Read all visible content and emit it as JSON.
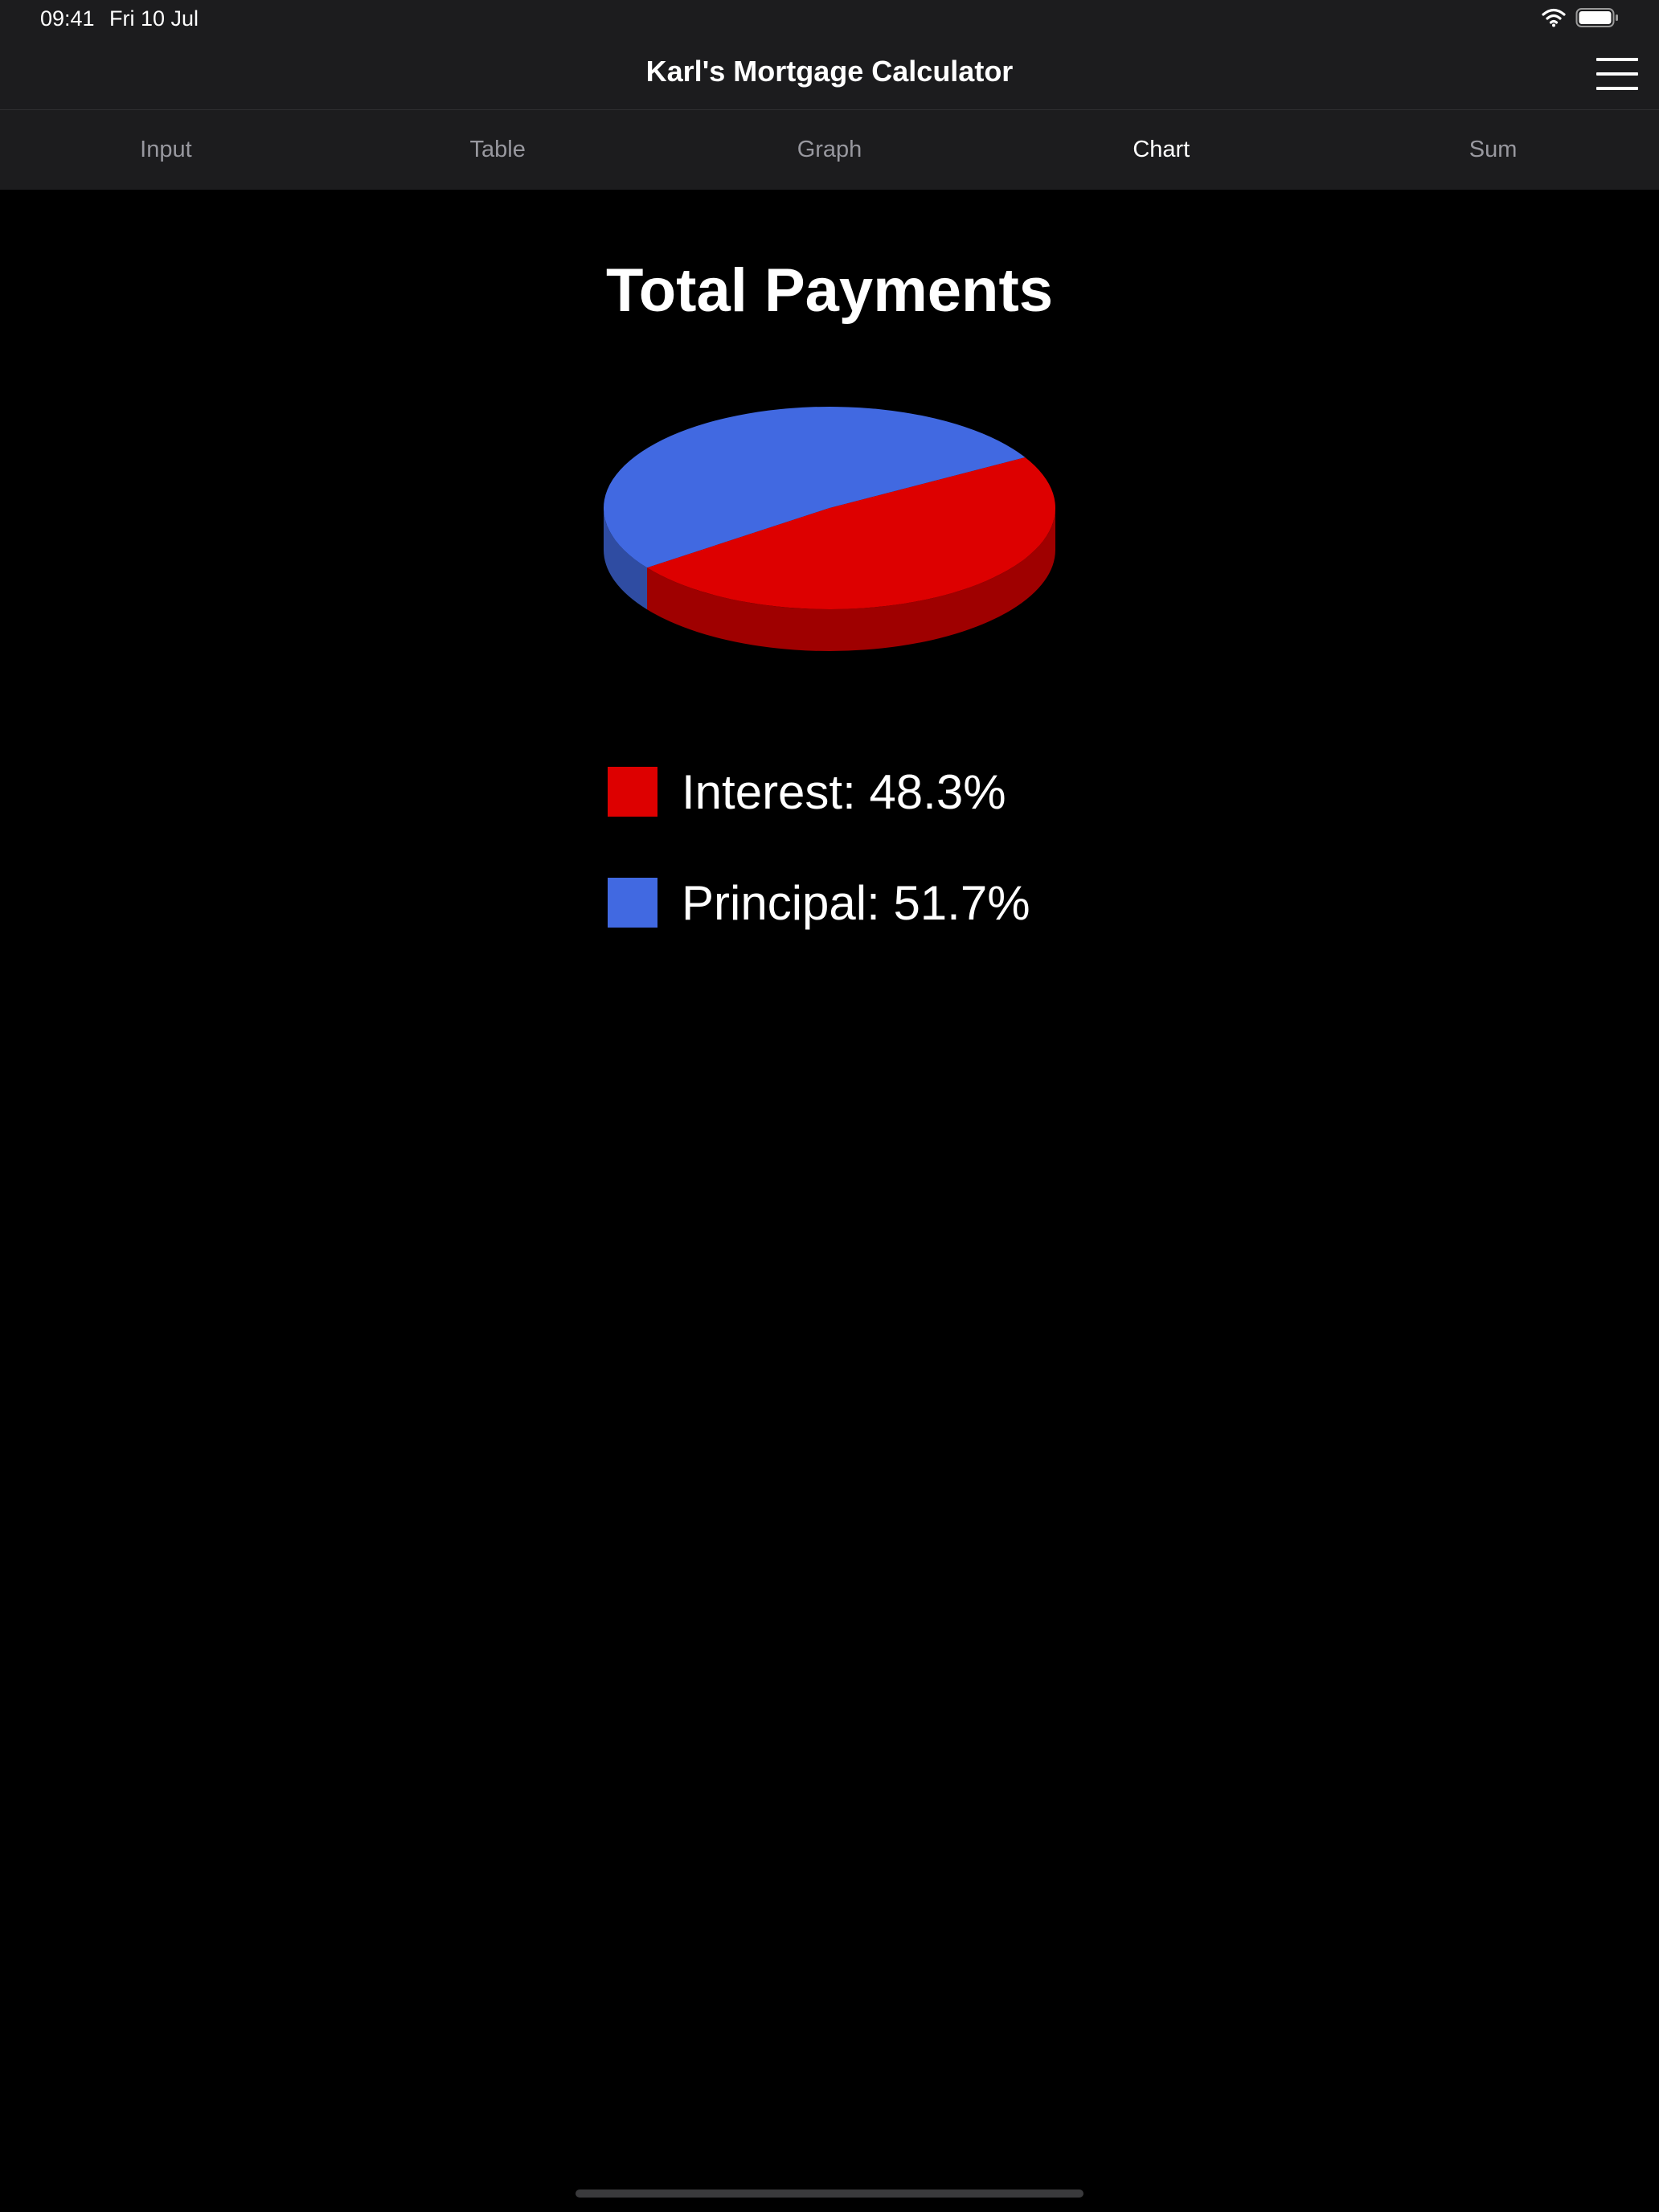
{
  "status_bar": {
    "time": "09:41",
    "date": "Fri 10 Jul",
    "wifi_icon": "wifi-icon",
    "battery_icon": "battery-icon"
  },
  "nav": {
    "title": "Karl's Mortgage Calculator",
    "menu_icon": "hamburger-menu-icon"
  },
  "tabs": [
    {
      "label": "Input",
      "active": false
    },
    {
      "label": "Table",
      "active": false
    },
    {
      "label": "Graph",
      "active": false
    },
    {
      "label": "Chart",
      "active": true
    },
    {
      "label": "Sum",
      "active": false
    }
  ],
  "chart_data": {
    "type": "pie",
    "title": "Total Payments",
    "style": "3d",
    "legend_placement": "bottom",
    "slices": [
      {
        "label": "Interest",
        "value": 48.3,
        "legend_text": "Interest: 48.3%",
        "color": "#dd0000"
      },
      {
        "label": "Principal",
        "value": 51.7,
        "legend_text": "Principal: 51.7%",
        "color": "#4169e1"
      }
    ]
  },
  "colors": {
    "background": "#000000",
    "bar_background": "#1c1c1e",
    "tab_inactive": "#98989f",
    "tab_active": "#ffffff"
  }
}
